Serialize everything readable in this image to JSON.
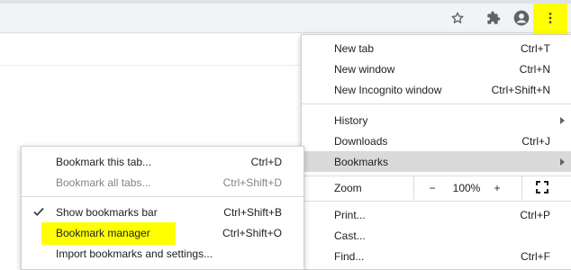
{
  "colors": {
    "highlight": "#ffff00",
    "menu_active": "#dadada",
    "toolbar_bg": "#f1f3f4"
  },
  "toolbar": {
    "icons": [
      "star-icon",
      "extensions-puzzle-icon",
      "profile-avatar-icon",
      "more-vertical-icon"
    ]
  },
  "main_menu": {
    "new_tab": {
      "label": "New tab",
      "shortcut": "Ctrl+T"
    },
    "new_window": {
      "label": "New window",
      "shortcut": "Ctrl+N"
    },
    "new_incognito": {
      "label": "New Incognito window",
      "shortcut": "Ctrl+Shift+N"
    },
    "history": {
      "label": "History"
    },
    "downloads": {
      "label": "Downloads",
      "shortcut": "Ctrl+J"
    },
    "bookmarks": {
      "label": "Bookmarks"
    },
    "zoom": {
      "label": "Zoom",
      "minus": "−",
      "level": "100%",
      "plus": "+"
    },
    "print": {
      "label": "Print...",
      "shortcut": "Ctrl+P"
    },
    "cast": {
      "label": "Cast..."
    },
    "find": {
      "label": "Find...",
      "shortcut": "Ctrl+F"
    }
  },
  "bookmarks_submenu": {
    "bookmark_tab": {
      "label": "Bookmark this tab...",
      "shortcut": "Ctrl+D"
    },
    "bookmark_all": {
      "label": "Bookmark all tabs...",
      "shortcut": "Ctrl+Shift+D"
    },
    "show_bar": {
      "label": "Show bookmarks bar",
      "shortcut": "Ctrl+Shift+B",
      "checked": true
    },
    "manager": {
      "label": "Bookmark manager",
      "shortcut": "Ctrl+Shift+O"
    },
    "import": {
      "label": "Import bookmarks and settings..."
    }
  }
}
